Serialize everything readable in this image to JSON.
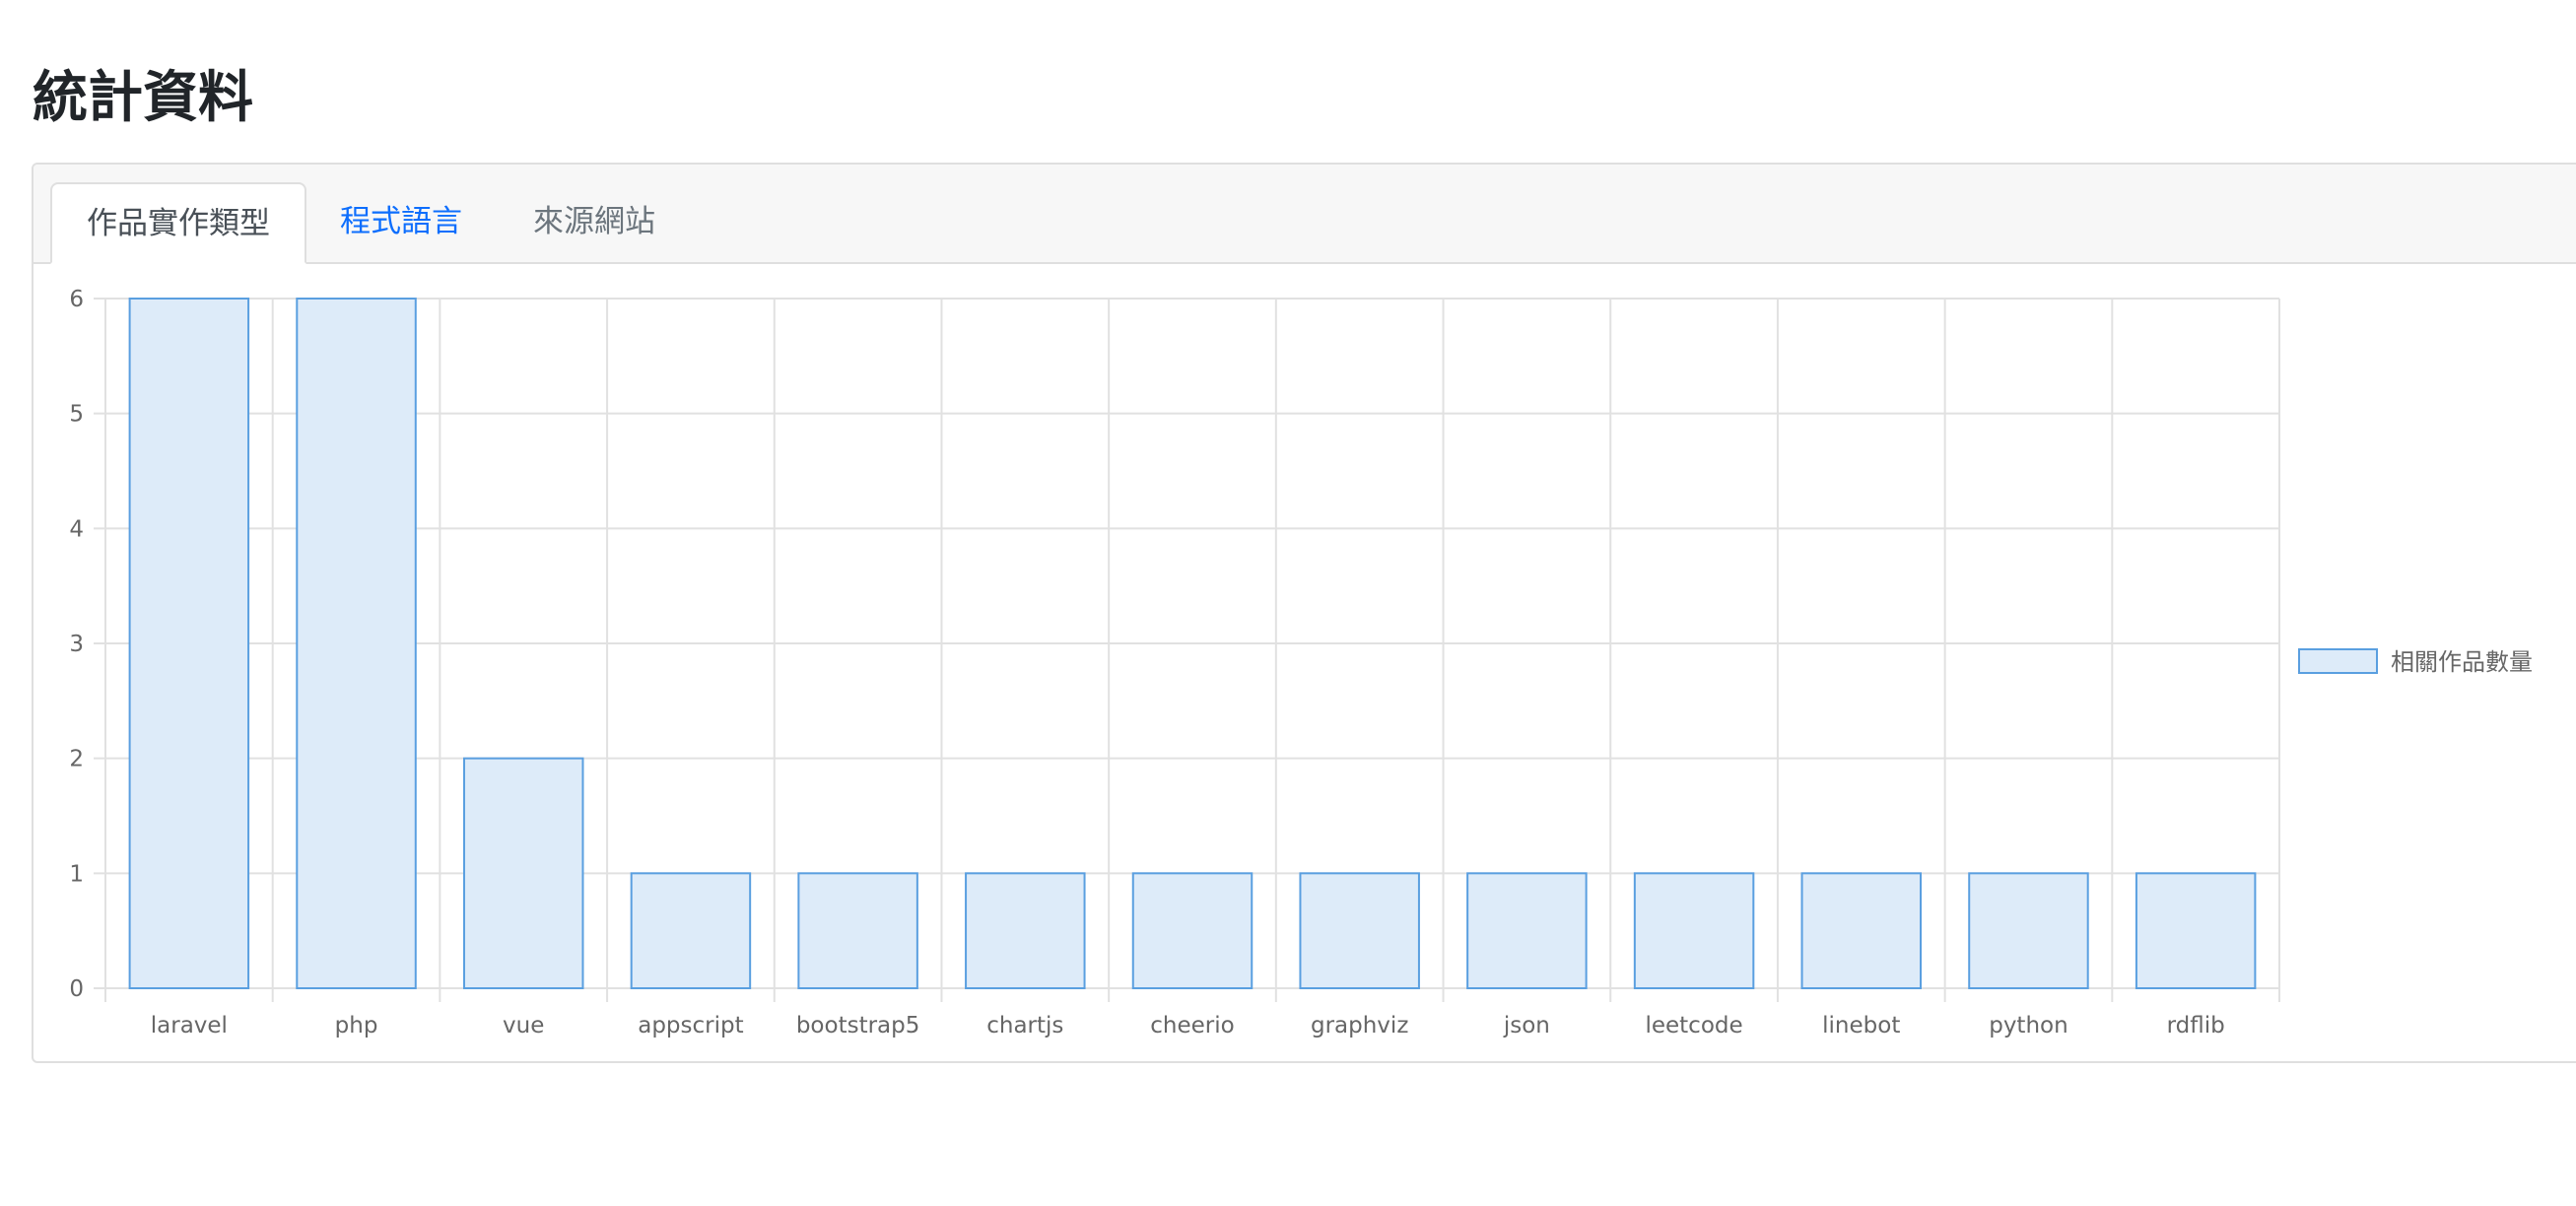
{
  "page": {
    "title": "統計資料"
  },
  "tabs": [
    {
      "label": "作品實作類型",
      "state": "active"
    },
    {
      "label": "程式語言",
      "state": "link"
    },
    {
      "label": "來源網站",
      "state": "inactive"
    }
  ],
  "colors": {
    "bar_fill": "#ddebf9",
    "bar_stroke": "#5a9fe0",
    "grid": "#e1e1e1",
    "link": "#0d6efd"
  },
  "chart_data": {
    "type": "bar",
    "categories": [
      "laravel",
      "php",
      "vue",
      "appscript",
      "bootstrap5",
      "chartjs",
      "cheerio",
      "graphviz",
      "json",
      "leetcode",
      "linebot",
      "python",
      "rdflib"
    ],
    "series": [
      {
        "name": "相關作品數量",
        "values": [
          6,
          6,
          2,
          1,
          1,
          1,
          1,
          1,
          1,
          1,
          1,
          1,
          1
        ]
      }
    ],
    "ylim": [
      0,
      6
    ],
    "yticks": [
      0,
      1,
      2,
      3,
      4,
      5,
      6
    ],
    "grid": true,
    "legend_position": "right"
  }
}
